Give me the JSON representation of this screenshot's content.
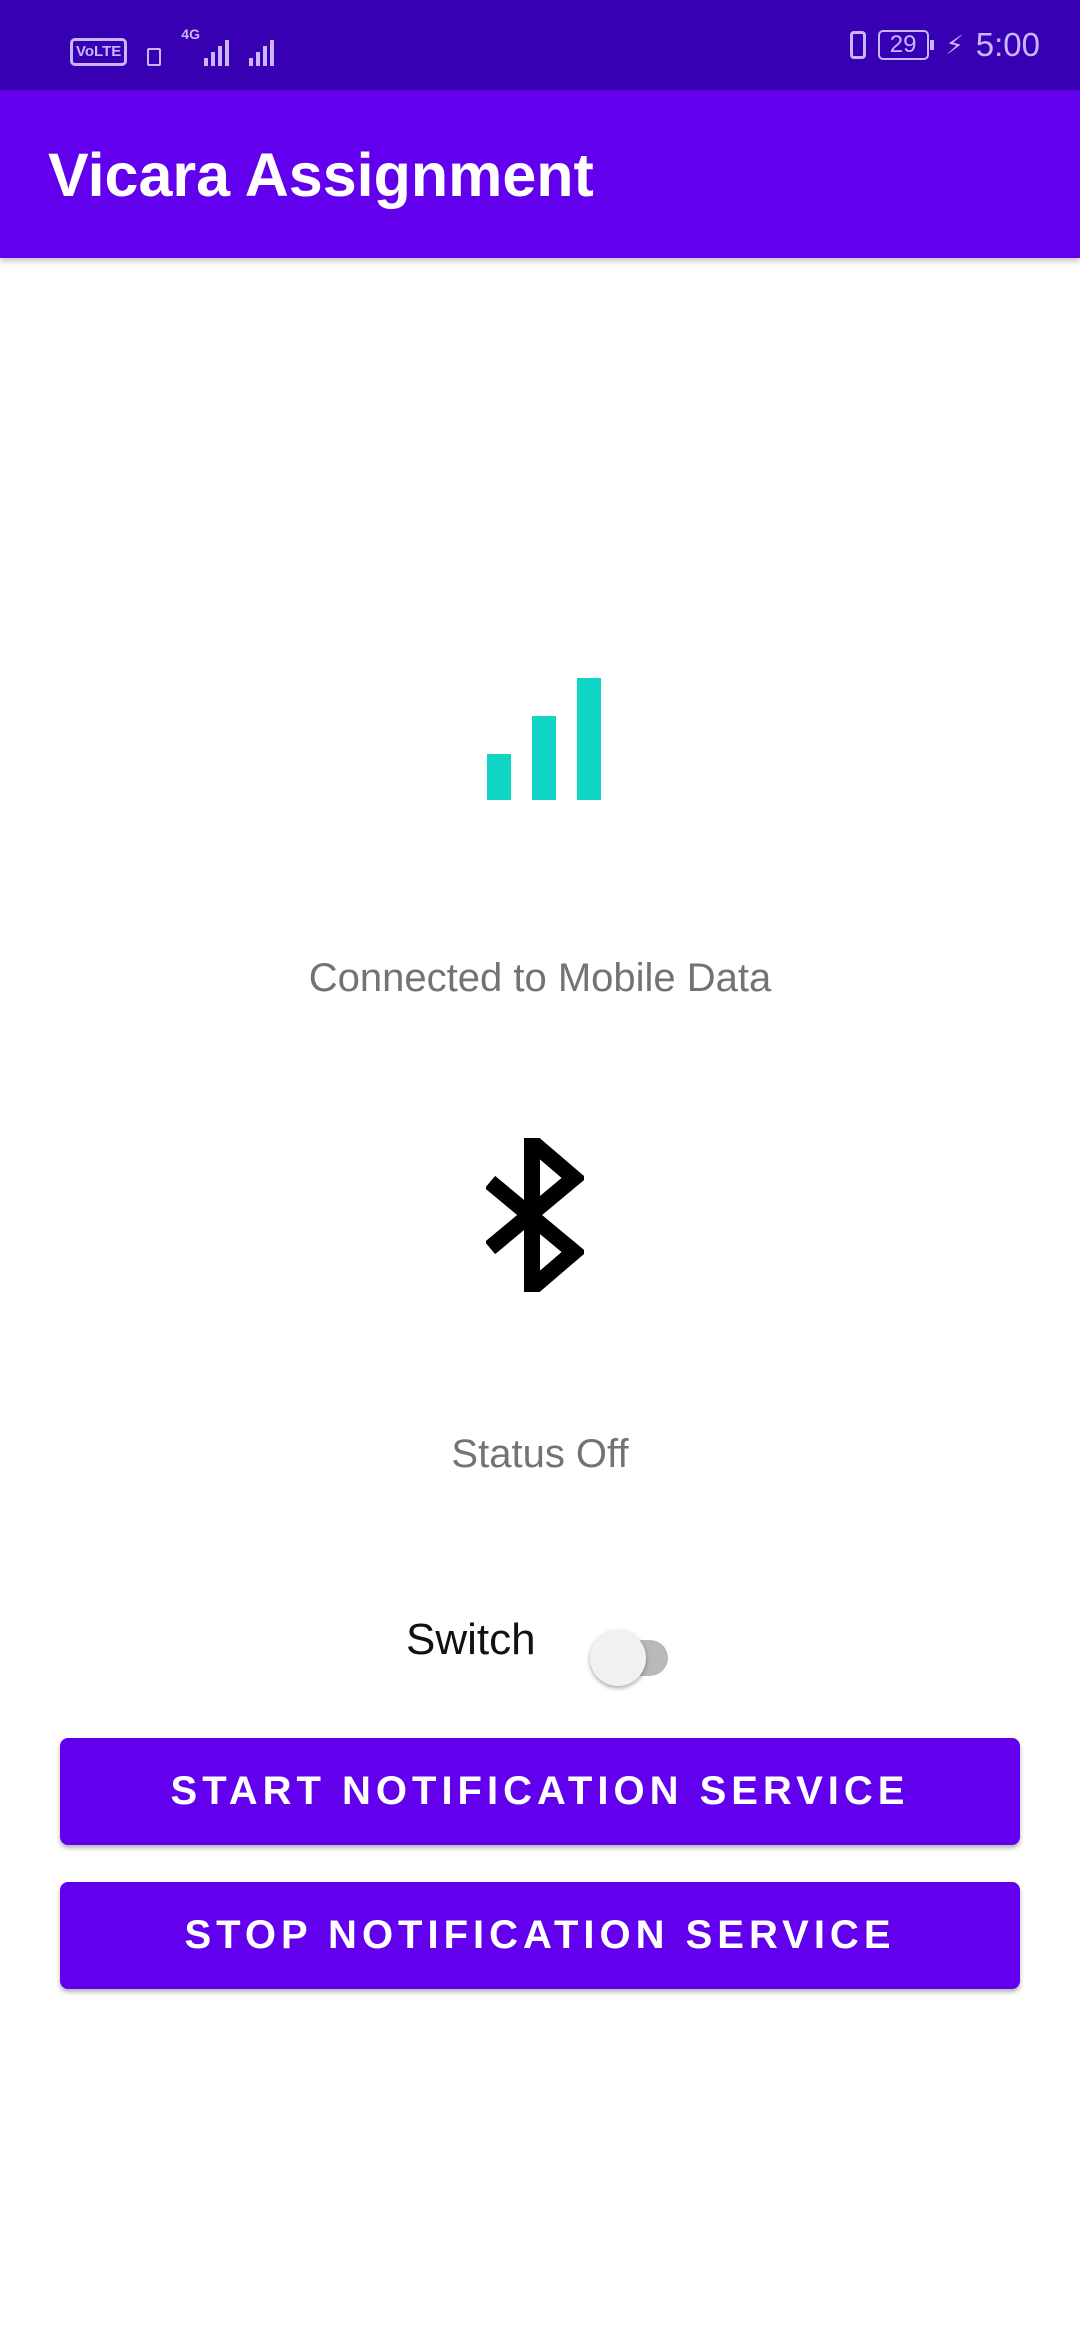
{
  "status_bar": {
    "volte": "VoLTE",
    "network_type": "4G",
    "battery_level": "29",
    "time": "5:00",
    "icons": [
      "volte-icon",
      "sim-icon",
      "signal-icon",
      "signal-icon",
      "vibrate-icon",
      "battery-icon",
      "charging-icon"
    ]
  },
  "app_bar": {
    "title": "Vicara Assignment"
  },
  "network": {
    "icon": "cellular-signal-icon",
    "status_text": "Connected to Mobile Data"
  },
  "bluetooth": {
    "icon": "bluetooth-icon",
    "status_text": "Status Off"
  },
  "switch": {
    "label": "Switch",
    "checked": false
  },
  "buttons": {
    "start_label": "START NOTIFICATION SERVICE",
    "stop_label": "STOP NOTIFICATION SERVICE"
  },
  "colors": {
    "status_bar": "#3700b3",
    "primary": "#6200ee",
    "signal_accent": "#0fd6c4",
    "secondary_text": "#737373"
  }
}
